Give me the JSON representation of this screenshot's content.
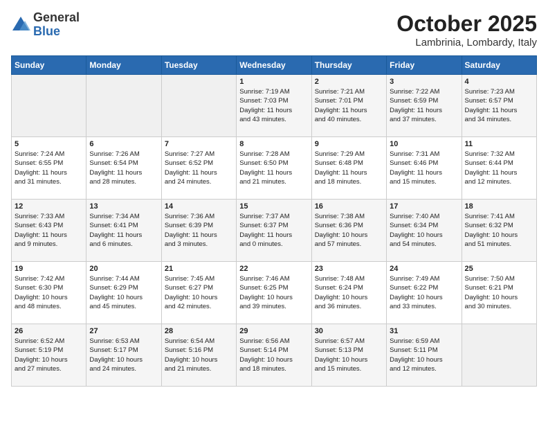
{
  "header": {
    "logo_general": "General",
    "logo_blue": "Blue",
    "month_title": "October 2025",
    "location": "Lambrinia, Lombardy, Italy"
  },
  "days_of_week": [
    "Sunday",
    "Monday",
    "Tuesday",
    "Wednesday",
    "Thursday",
    "Friday",
    "Saturday"
  ],
  "weeks": [
    [
      {
        "day": "",
        "info": ""
      },
      {
        "day": "",
        "info": ""
      },
      {
        "day": "",
        "info": ""
      },
      {
        "day": "1",
        "info": "Sunrise: 7:19 AM\nSunset: 7:03 PM\nDaylight: 11 hours\nand 43 minutes."
      },
      {
        "day": "2",
        "info": "Sunrise: 7:21 AM\nSunset: 7:01 PM\nDaylight: 11 hours\nand 40 minutes."
      },
      {
        "day": "3",
        "info": "Sunrise: 7:22 AM\nSunset: 6:59 PM\nDaylight: 11 hours\nand 37 minutes."
      },
      {
        "day": "4",
        "info": "Sunrise: 7:23 AM\nSunset: 6:57 PM\nDaylight: 11 hours\nand 34 minutes."
      }
    ],
    [
      {
        "day": "5",
        "info": "Sunrise: 7:24 AM\nSunset: 6:55 PM\nDaylight: 11 hours\nand 31 minutes."
      },
      {
        "day": "6",
        "info": "Sunrise: 7:26 AM\nSunset: 6:54 PM\nDaylight: 11 hours\nand 28 minutes."
      },
      {
        "day": "7",
        "info": "Sunrise: 7:27 AM\nSunset: 6:52 PM\nDaylight: 11 hours\nand 24 minutes."
      },
      {
        "day": "8",
        "info": "Sunrise: 7:28 AM\nSunset: 6:50 PM\nDaylight: 11 hours\nand 21 minutes."
      },
      {
        "day": "9",
        "info": "Sunrise: 7:29 AM\nSunset: 6:48 PM\nDaylight: 11 hours\nand 18 minutes."
      },
      {
        "day": "10",
        "info": "Sunrise: 7:31 AM\nSunset: 6:46 PM\nDaylight: 11 hours\nand 15 minutes."
      },
      {
        "day": "11",
        "info": "Sunrise: 7:32 AM\nSunset: 6:44 PM\nDaylight: 11 hours\nand 12 minutes."
      }
    ],
    [
      {
        "day": "12",
        "info": "Sunrise: 7:33 AM\nSunset: 6:43 PM\nDaylight: 11 hours\nand 9 minutes."
      },
      {
        "day": "13",
        "info": "Sunrise: 7:34 AM\nSunset: 6:41 PM\nDaylight: 11 hours\nand 6 minutes."
      },
      {
        "day": "14",
        "info": "Sunrise: 7:36 AM\nSunset: 6:39 PM\nDaylight: 11 hours\nand 3 minutes."
      },
      {
        "day": "15",
        "info": "Sunrise: 7:37 AM\nSunset: 6:37 PM\nDaylight: 11 hours\nand 0 minutes."
      },
      {
        "day": "16",
        "info": "Sunrise: 7:38 AM\nSunset: 6:36 PM\nDaylight: 10 hours\nand 57 minutes."
      },
      {
        "day": "17",
        "info": "Sunrise: 7:40 AM\nSunset: 6:34 PM\nDaylight: 10 hours\nand 54 minutes."
      },
      {
        "day": "18",
        "info": "Sunrise: 7:41 AM\nSunset: 6:32 PM\nDaylight: 10 hours\nand 51 minutes."
      }
    ],
    [
      {
        "day": "19",
        "info": "Sunrise: 7:42 AM\nSunset: 6:30 PM\nDaylight: 10 hours\nand 48 minutes."
      },
      {
        "day": "20",
        "info": "Sunrise: 7:44 AM\nSunset: 6:29 PM\nDaylight: 10 hours\nand 45 minutes."
      },
      {
        "day": "21",
        "info": "Sunrise: 7:45 AM\nSunset: 6:27 PM\nDaylight: 10 hours\nand 42 minutes."
      },
      {
        "day": "22",
        "info": "Sunrise: 7:46 AM\nSunset: 6:25 PM\nDaylight: 10 hours\nand 39 minutes."
      },
      {
        "day": "23",
        "info": "Sunrise: 7:48 AM\nSunset: 6:24 PM\nDaylight: 10 hours\nand 36 minutes."
      },
      {
        "day": "24",
        "info": "Sunrise: 7:49 AM\nSunset: 6:22 PM\nDaylight: 10 hours\nand 33 minutes."
      },
      {
        "day": "25",
        "info": "Sunrise: 7:50 AM\nSunset: 6:21 PM\nDaylight: 10 hours\nand 30 minutes."
      }
    ],
    [
      {
        "day": "26",
        "info": "Sunrise: 6:52 AM\nSunset: 5:19 PM\nDaylight: 10 hours\nand 27 minutes."
      },
      {
        "day": "27",
        "info": "Sunrise: 6:53 AM\nSunset: 5:17 PM\nDaylight: 10 hours\nand 24 minutes."
      },
      {
        "day": "28",
        "info": "Sunrise: 6:54 AM\nSunset: 5:16 PM\nDaylight: 10 hours\nand 21 minutes."
      },
      {
        "day": "29",
        "info": "Sunrise: 6:56 AM\nSunset: 5:14 PM\nDaylight: 10 hours\nand 18 minutes."
      },
      {
        "day": "30",
        "info": "Sunrise: 6:57 AM\nSunset: 5:13 PM\nDaylight: 10 hours\nand 15 minutes."
      },
      {
        "day": "31",
        "info": "Sunrise: 6:59 AM\nSunset: 5:11 PM\nDaylight: 10 hours\nand 12 minutes."
      },
      {
        "day": "",
        "info": ""
      }
    ]
  ]
}
